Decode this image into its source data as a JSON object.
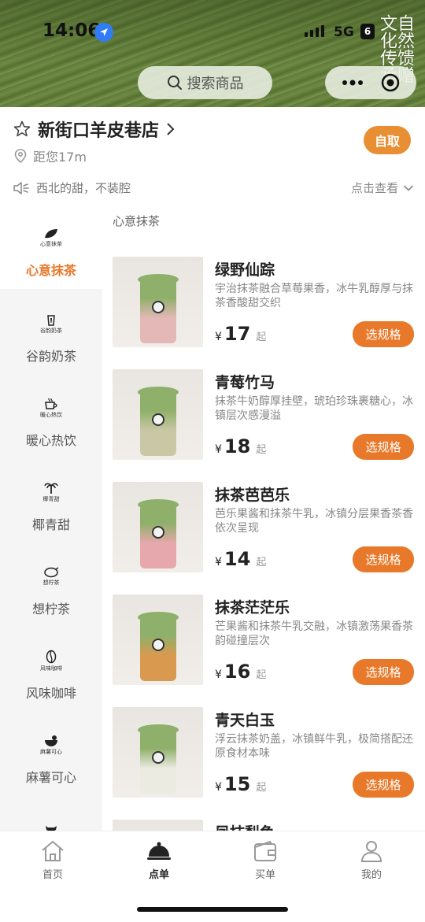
{
  "status_bar": {
    "time": "14:06",
    "network": "5G",
    "battery": "6"
  },
  "banner": {
    "calligraphy": "自然馈赠文化传承"
  },
  "search": {
    "label": "搜索商品"
  },
  "store": {
    "name": "新街口羊皮巷店",
    "distance": "距您17m",
    "pickup_label": "自取",
    "notice": "西北的甜，不装腔",
    "notice_more": "点击查看"
  },
  "sidebar": {
    "items": [
      {
        "label": "心意抹茶",
        "mini": "心意抹茶",
        "active": true
      },
      {
        "label": "谷韵奶茶",
        "mini": "谷韵奶茶",
        "active": false
      },
      {
        "label": "暖心热饮",
        "mini": "暖心热饮",
        "active": false
      },
      {
        "label": "椰青甜",
        "mini": "椰青甜",
        "active": false
      },
      {
        "label": "想柠茶",
        "mini": "想柠茶",
        "active": false
      },
      {
        "label": "风味咖啡",
        "mini": "风味咖啡",
        "active": false
      },
      {
        "label": "麻薯可心",
        "mini": "麻薯可心",
        "active": false
      }
    ]
  },
  "section_title": "心意抹茶",
  "products": [
    {
      "name": "绿野仙踪",
      "desc": "宇治抹茶融合草莓果香，冰牛乳醇厚与抹茶香酸甜交织",
      "currency": "¥",
      "price": "17",
      "price_suffix": "起",
      "button": "选规格",
      "cup_color": "#e3b8b6"
    },
    {
      "name": "青莓竹马",
      "desc": "抹茶牛奶醇厚挂壁，琥珀珍珠裹糖心，冰镇层次感漫溢",
      "currency": "¥",
      "price": "18",
      "price_suffix": "起",
      "button": "选规格",
      "cup_color": "#c9c7a4"
    },
    {
      "name": "抹茶芭芭乐",
      "desc": "芭乐果酱和抹茶牛乳，冰镇分层果香茶香依次呈现",
      "currency": "¥",
      "price": "14",
      "price_suffix": "起",
      "button": "选规格",
      "cup_color": "#e6a8ac"
    },
    {
      "name": "抹茶茫茫乐",
      "desc": "芒果酱和抹茶牛乳交融，冰镇激荡果香茶韵碰撞层次",
      "currency": "¥",
      "price": "16",
      "price_suffix": "起",
      "button": "选规格",
      "cup_color": "#d99a4f"
    },
    {
      "name": "青天白玉",
      "desc": "浮云抹茶奶盖，冰镇鲜牛乳，极简搭配还原食材本味",
      "currency": "¥",
      "price": "15",
      "price_suffix": "起",
      "button": "选规格",
      "cup_color": "#ecebe2"
    },
    {
      "name": "凤抹梨鱼",
      "desc": "",
      "currency": "",
      "price": "",
      "price_suffix": "",
      "button": "",
      "cup_color": "#d9d5cf"
    }
  ],
  "tabbar": {
    "items": [
      {
        "label": "首页",
        "icon": "home-icon",
        "active": false
      },
      {
        "label": "点单",
        "icon": "cloche-icon",
        "active": true
      },
      {
        "label": "买单",
        "icon": "wallet-icon",
        "active": false
      },
      {
        "label": "我的",
        "icon": "user-icon",
        "active": false
      }
    ]
  },
  "colors": {
    "accent": "#e8792b",
    "pickup": "#e88e33"
  }
}
